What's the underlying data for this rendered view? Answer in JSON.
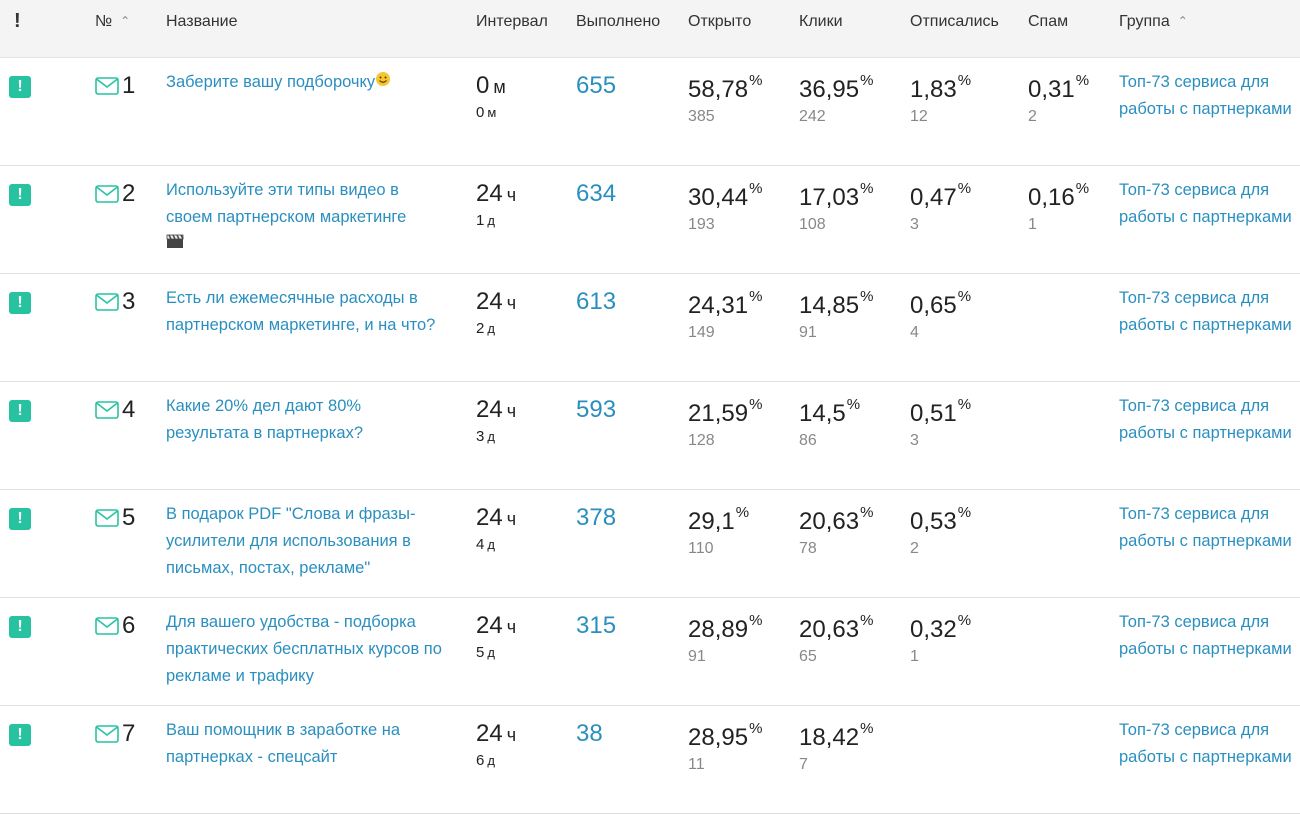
{
  "header": {
    "status": "!",
    "number": "№",
    "name": "Название",
    "interval": "Интервал",
    "done": "Выполнено",
    "opened": "Открыто",
    "clicks": "Клики",
    "unsub": "Отписались",
    "spam": "Спам",
    "group": "Группа",
    "sort_arrow": "^"
  },
  "colors": {
    "accent": "#27c3a1",
    "link": "#2a8fbf"
  },
  "rows": [
    {
      "badge": "!",
      "num": "1",
      "title": "Заберите вашу подборочку",
      "emoji": "smiley-emoji",
      "interval_val": "0",
      "interval_unit": "м",
      "sub_val": "0",
      "sub_unit": "м",
      "done": "655",
      "opened": "58,78",
      "opened_cnt": "385",
      "clicks": "36,95",
      "clicks_cnt": "242",
      "unsub": "1,83",
      "unsub_cnt": "12",
      "spam": "0,31",
      "spam_cnt": "2",
      "group": "Топ-73 сервиса для работы с партнерками"
    },
    {
      "badge": "!",
      "num": "2",
      "title": "Используйте эти типы видео в своем партнерском маркетинге",
      "emoji": "clapper-emoji",
      "interval_val": "24",
      "interval_unit": "ч",
      "sub_val": "1",
      "sub_unit": "д",
      "done": "634",
      "opened": "30,44",
      "opened_cnt": "193",
      "clicks": "17,03",
      "clicks_cnt": "108",
      "unsub": "0,47",
      "unsub_cnt": "3",
      "spam": "0,16",
      "spam_cnt": "1",
      "group": "Топ-73 сервиса для работы с партнерками"
    },
    {
      "badge": "!",
      "num": "3",
      "title": "Есть ли ежемесячные расходы в партнерском маркетинге, и на что?",
      "interval_val": "24",
      "interval_unit": "ч",
      "sub_val": "2",
      "sub_unit": "д",
      "done": "613",
      "opened": "24,31",
      "opened_cnt": "149",
      "clicks": "14,85",
      "clicks_cnt": "91",
      "unsub": "0,65",
      "unsub_cnt": "4",
      "group": "Топ-73 сервиса для работы с партнерками"
    },
    {
      "badge": "!",
      "num": "4",
      "title": "Какие 20% дел дают 80% результата в партнерках?",
      "interval_val": "24",
      "interval_unit": "ч",
      "sub_val": "3",
      "sub_unit": "д",
      "done": "593",
      "opened": "21,59",
      "opened_cnt": "128",
      "clicks": "14,5",
      "clicks_cnt": "86",
      "unsub": "0,51",
      "unsub_cnt": "3",
      "group": "Топ-73 сервиса для работы с партнерками"
    },
    {
      "badge": "!",
      "num": "5",
      "title": "В подарок PDF \"Слова и фразы-усилители для использования в письмах, постах, рекламе\"",
      "interval_val": "24",
      "interval_unit": "ч",
      "sub_val": "4",
      "sub_unit": "д",
      "done": "378",
      "opened": "29,1",
      "opened_cnt": "110",
      "clicks": "20,63",
      "clicks_cnt": "78",
      "unsub": "0,53",
      "unsub_cnt": "2",
      "group": "Топ-73 сервиса для работы с партнерками"
    },
    {
      "badge": "!",
      "num": "6",
      "title": "Для вашего удобства - подборка практических бесплатных курсов по рекламе и трафику",
      "interval_val": "24",
      "interval_unit": "ч",
      "sub_val": "5",
      "sub_unit": "д",
      "done": "315",
      "opened": "28,89",
      "opened_cnt": "91",
      "clicks": "20,63",
      "clicks_cnt": "65",
      "unsub": "0,32",
      "unsub_cnt": "1",
      "group": "Топ-73 сервиса для работы с партнерками"
    },
    {
      "badge": "!",
      "num": "7",
      "title": "Ваш помощник в заработке на партнерках - спецсайт",
      "interval_val": "24",
      "interval_unit": "ч",
      "sub_val": "6",
      "sub_unit": "д",
      "done": "38",
      "opened": "28,95",
      "opened_cnt": "11",
      "clicks": "18,42",
      "clicks_cnt": "7",
      "group": "Топ-73 сервиса для работы с партнерками"
    }
  ],
  "percent_sign": "%"
}
